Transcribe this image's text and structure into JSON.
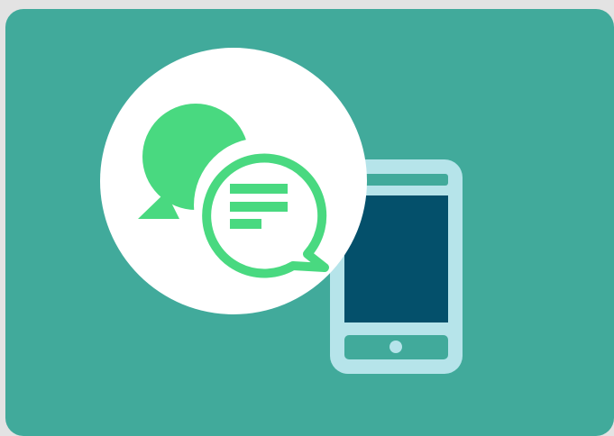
{
  "illustration": {
    "subject": "chat-bubbles-over-smartphone",
    "icons": [
      "chat-bubble-icon",
      "message-bubble-icon",
      "smartphone-icon"
    ]
  },
  "colors": {
    "page_background": "#e3e3e3",
    "card_background": "#41aa9b",
    "circle_background": "#ffffff",
    "bubble_green": "#49d980",
    "phone_frame": "#b6e4ea",
    "phone_screen": "#04506b"
  }
}
